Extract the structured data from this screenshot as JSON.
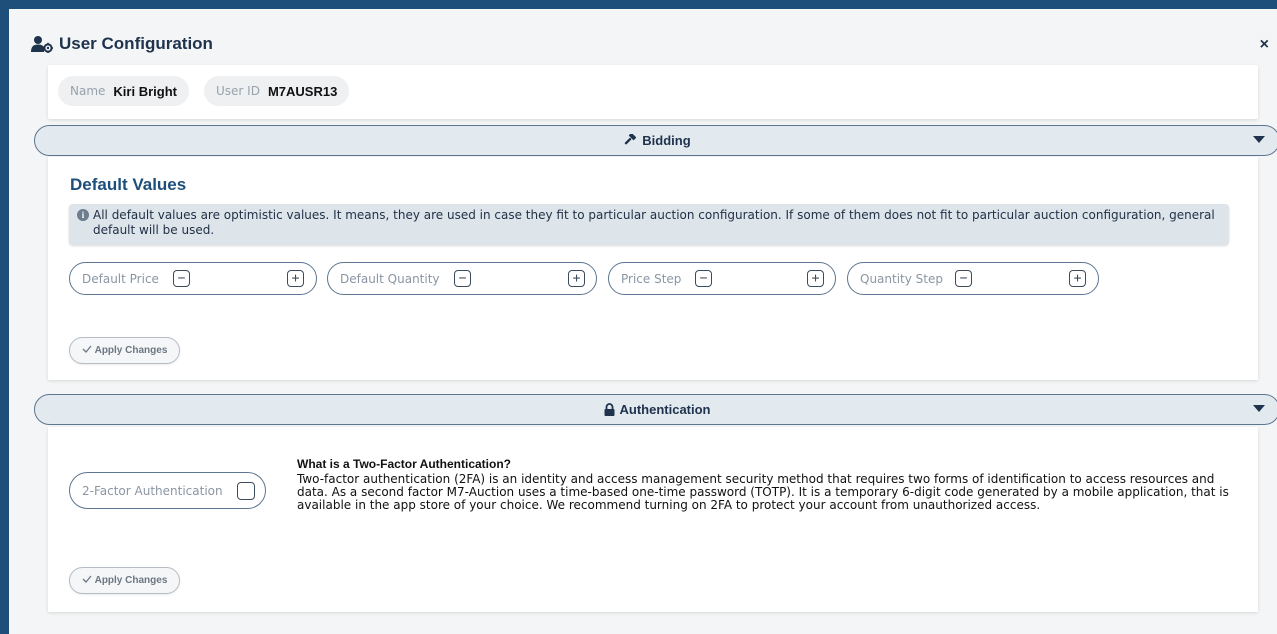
{
  "dialog": {
    "title": "User Configuration",
    "title_icon": "user-gear-icon",
    "close_label": "×"
  },
  "user": {
    "name_label": "Name",
    "name_value": "Kiri Bright",
    "id_label": "User ID",
    "id_value": "M7AUSR13"
  },
  "bidding": {
    "header": "Bidding",
    "header_icon": "gavel-icon",
    "title": "Default Values",
    "info_icon": "info-icon",
    "info": "All default values are optimistic values. It means, they are used in case they fit to particular auction configuration. If some of them does not fit to particular auction configuration, general default will be used.",
    "fields": [
      {
        "label": "Default Price"
      },
      {
        "label": "Default Quantity"
      },
      {
        "label": "Price Step"
      },
      {
        "label": "Quantity Step"
      }
    ],
    "minus": "−",
    "plus": "+",
    "apply_label": "Apply Changes"
  },
  "auth": {
    "header": "Authentication",
    "header_icon": "lock-icon",
    "tfa_label": "2-Factor Authentication",
    "tfa_checked": false,
    "heading": "What is a Two-Factor Authentication?",
    "description": "Two-factor authentication (2FA) is an identity and access management security method that requires two forms of identification to access resources and data. As a second factor M7-Auction uses a time-based one-time password (TOTP). It is a temporary 6-digit code generated by a mobile application, that is available in the app store of your choice. We recommend turning on 2FA to protect your account from unauthorized access.",
    "apply_label": "Apply Changes"
  },
  "colors": {
    "background": "#1e4f7a",
    "accent": "#1e4f7a",
    "section_bar": "#e2e9ef",
    "border": "#5c7590"
  }
}
